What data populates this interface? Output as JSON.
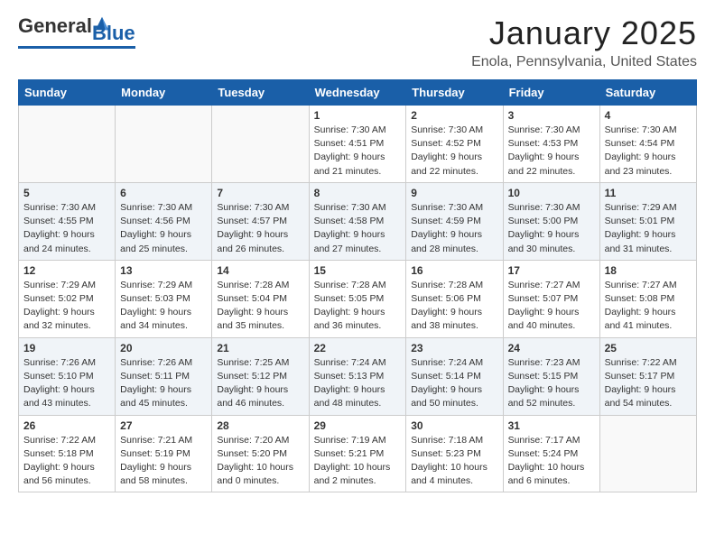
{
  "header": {
    "logo_general": "General",
    "logo_blue": "Blue",
    "month_title": "January 2025",
    "location": "Enola, Pennsylvania, United States"
  },
  "weekdays": [
    "Sunday",
    "Monday",
    "Tuesday",
    "Wednesday",
    "Thursday",
    "Friday",
    "Saturday"
  ],
  "weeks": [
    [
      {
        "day": "",
        "info": ""
      },
      {
        "day": "",
        "info": ""
      },
      {
        "day": "",
        "info": ""
      },
      {
        "day": "1",
        "info": "Sunrise: 7:30 AM\nSunset: 4:51 PM\nDaylight: 9 hours\nand 21 minutes."
      },
      {
        "day": "2",
        "info": "Sunrise: 7:30 AM\nSunset: 4:52 PM\nDaylight: 9 hours\nand 22 minutes."
      },
      {
        "day": "3",
        "info": "Sunrise: 7:30 AM\nSunset: 4:53 PM\nDaylight: 9 hours\nand 22 minutes."
      },
      {
        "day": "4",
        "info": "Sunrise: 7:30 AM\nSunset: 4:54 PM\nDaylight: 9 hours\nand 23 minutes."
      }
    ],
    [
      {
        "day": "5",
        "info": "Sunrise: 7:30 AM\nSunset: 4:55 PM\nDaylight: 9 hours\nand 24 minutes."
      },
      {
        "day": "6",
        "info": "Sunrise: 7:30 AM\nSunset: 4:56 PM\nDaylight: 9 hours\nand 25 minutes."
      },
      {
        "day": "7",
        "info": "Sunrise: 7:30 AM\nSunset: 4:57 PM\nDaylight: 9 hours\nand 26 minutes."
      },
      {
        "day": "8",
        "info": "Sunrise: 7:30 AM\nSunset: 4:58 PM\nDaylight: 9 hours\nand 27 minutes."
      },
      {
        "day": "9",
        "info": "Sunrise: 7:30 AM\nSunset: 4:59 PM\nDaylight: 9 hours\nand 28 minutes."
      },
      {
        "day": "10",
        "info": "Sunrise: 7:30 AM\nSunset: 5:00 PM\nDaylight: 9 hours\nand 30 minutes."
      },
      {
        "day": "11",
        "info": "Sunrise: 7:29 AM\nSunset: 5:01 PM\nDaylight: 9 hours\nand 31 minutes."
      }
    ],
    [
      {
        "day": "12",
        "info": "Sunrise: 7:29 AM\nSunset: 5:02 PM\nDaylight: 9 hours\nand 32 minutes."
      },
      {
        "day": "13",
        "info": "Sunrise: 7:29 AM\nSunset: 5:03 PM\nDaylight: 9 hours\nand 34 minutes."
      },
      {
        "day": "14",
        "info": "Sunrise: 7:28 AM\nSunset: 5:04 PM\nDaylight: 9 hours\nand 35 minutes."
      },
      {
        "day": "15",
        "info": "Sunrise: 7:28 AM\nSunset: 5:05 PM\nDaylight: 9 hours\nand 36 minutes."
      },
      {
        "day": "16",
        "info": "Sunrise: 7:28 AM\nSunset: 5:06 PM\nDaylight: 9 hours\nand 38 minutes."
      },
      {
        "day": "17",
        "info": "Sunrise: 7:27 AM\nSunset: 5:07 PM\nDaylight: 9 hours\nand 40 minutes."
      },
      {
        "day": "18",
        "info": "Sunrise: 7:27 AM\nSunset: 5:08 PM\nDaylight: 9 hours\nand 41 minutes."
      }
    ],
    [
      {
        "day": "19",
        "info": "Sunrise: 7:26 AM\nSunset: 5:10 PM\nDaylight: 9 hours\nand 43 minutes."
      },
      {
        "day": "20",
        "info": "Sunrise: 7:26 AM\nSunset: 5:11 PM\nDaylight: 9 hours\nand 45 minutes."
      },
      {
        "day": "21",
        "info": "Sunrise: 7:25 AM\nSunset: 5:12 PM\nDaylight: 9 hours\nand 46 minutes."
      },
      {
        "day": "22",
        "info": "Sunrise: 7:24 AM\nSunset: 5:13 PM\nDaylight: 9 hours\nand 48 minutes."
      },
      {
        "day": "23",
        "info": "Sunrise: 7:24 AM\nSunset: 5:14 PM\nDaylight: 9 hours\nand 50 minutes."
      },
      {
        "day": "24",
        "info": "Sunrise: 7:23 AM\nSunset: 5:15 PM\nDaylight: 9 hours\nand 52 minutes."
      },
      {
        "day": "25",
        "info": "Sunrise: 7:22 AM\nSunset: 5:17 PM\nDaylight: 9 hours\nand 54 minutes."
      }
    ],
    [
      {
        "day": "26",
        "info": "Sunrise: 7:22 AM\nSunset: 5:18 PM\nDaylight: 9 hours\nand 56 minutes."
      },
      {
        "day": "27",
        "info": "Sunrise: 7:21 AM\nSunset: 5:19 PM\nDaylight: 9 hours\nand 58 minutes."
      },
      {
        "day": "28",
        "info": "Sunrise: 7:20 AM\nSunset: 5:20 PM\nDaylight: 10 hours\nand 0 minutes."
      },
      {
        "day": "29",
        "info": "Sunrise: 7:19 AM\nSunset: 5:21 PM\nDaylight: 10 hours\nand 2 minutes."
      },
      {
        "day": "30",
        "info": "Sunrise: 7:18 AM\nSunset: 5:23 PM\nDaylight: 10 hours\nand 4 minutes."
      },
      {
        "day": "31",
        "info": "Sunrise: 7:17 AM\nSunset: 5:24 PM\nDaylight: 10 hours\nand 6 minutes."
      },
      {
        "day": "",
        "info": ""
      }
    ]
  ]
}
